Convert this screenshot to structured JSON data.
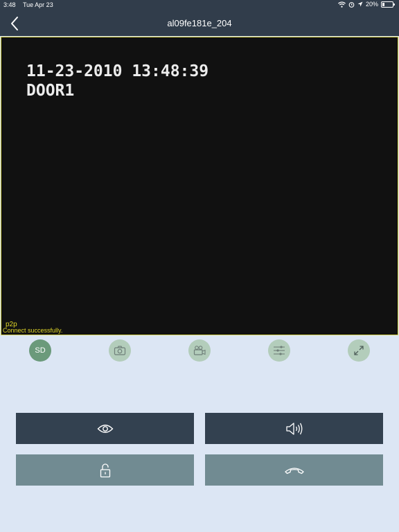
{
  "status_bar": {
    "time": "3:48",
    "date": "Tue Apr 23",
    "battery": "20%",
    "icons": [
      "wifi-icon",
      "alarm-icon",
      "location-icon",
      "battery-icon"
    ]
  },
  "nav": {
    "title": "al09fe181e_204",
    "back_icon": "chevron-left-icon"
  },
  "video": {
    "osd_datetime": "11-23-2010 13:48:39",
    "osd_label": "DOOR1",
    "mode": "p2p",
    "status": "Connect successfully."
  },
  "toolbar": {
    "sd_label": "SD",
    "icons": [
      "camera-icon",
      "video-record-icon",
      "sliders-icon",
      "fullscreen-icon"
    ]
  },
  "controls": [
    "eye-icon",
    "speaker-icon",
    "unlock-icon",
    "hang-up-icon"
  ],
  "colors": {
    "header": "#313d4b",
    "background": "#dce6f4",
    "dark_button": "#334150",
    "gray_button": "#718b92",
    "accent_green": "#6b9a7b",
    "status_text": "#e0d628"
  }
}
